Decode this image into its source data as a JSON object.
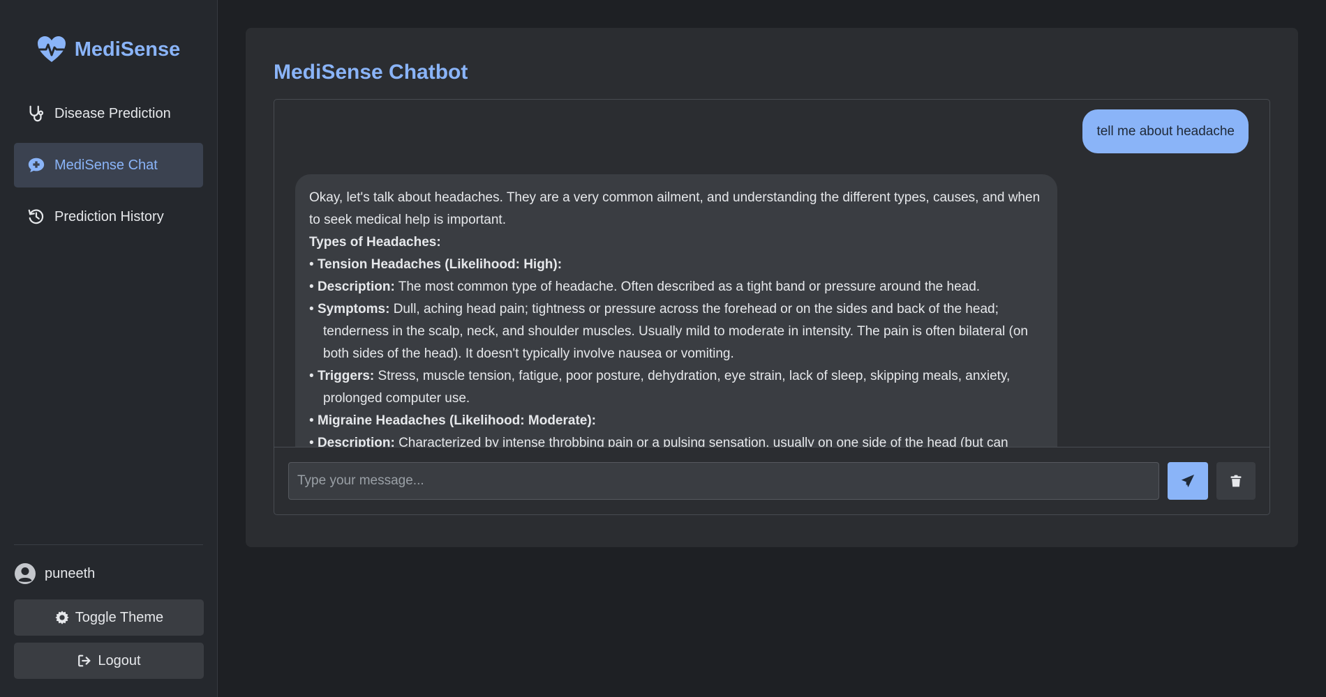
{
  "brand": {
    "name": "MediSense"
  },
  "nav": {
    "items": [
      {
        "label": "Disease Prediction",
        "icon": "stethoscope-icon",
        "active": false
      },
      {
        "label": "MediSense Chat",
        "icon": "chat-medical-icon",
        "active": true
      },
      {
        "label": "Prediction History",
        "icon": "history-icon",
        "active": false
      }
    ]
  },
  "user": {
    "name": "puneeth"
  },
  "footer": {
    "toggle_theme_label": "Toggle Theme",
    "logout_label": "Logout"
  },
  "chat": {
    "title": "MediSense Chatbot",
    "user_message": "tell me about headache",
    "bot_message": {
      "intro": "Okay, let's talk about headaches. They are a very common ailment, and understanding the different types, causes, and when to seek medical help is important.",
      "heading_types": "Types of Headaches:",
      "tension_heading": "Tension Headaches (Likelihood: High):",
      "tension_desc_label": "Description:",
      "tension_desc": "The most common type of headache. Often described as a tight band or pressure around the head.",
      "tension_symptoms_label": "Symptoms:",
      "tension_symptoms": "Dull, aching head pain; tightness or pressure across the forehead or on the sides and back of the head; tenderness in the scalp, neck, and shoulder muscles. Usually mild to moderate in intensity. The pain is often bilateral (on both sides of the head). It doesn't typically involve nausea or vomiting.",
      "tension_triggers_label": "Triggers:",
      "tension_triggers": "Stress, muscle tension, fatigue, poor posture, dehydration, eye strain, lack of sleep, skipping meals, anxiety, prolonged computer use.",
      "migraine_heading": "Migraine Headaches (Likelihood: Moderate):",
      "migraine_desc_label": "Description:",
      "migraine_desc": "Characterized by intense throbbing pain or a pulsing sensation, usually on one side of the head (but can"
    },
    "input_placeholder": "Type your message..."
  },
  "colors": {
    "accent": "#8ab4f8",
    "background": "#1e2024",
    "sidebar": "#25282d",
    "card": "#2b2d31"
  }
}
